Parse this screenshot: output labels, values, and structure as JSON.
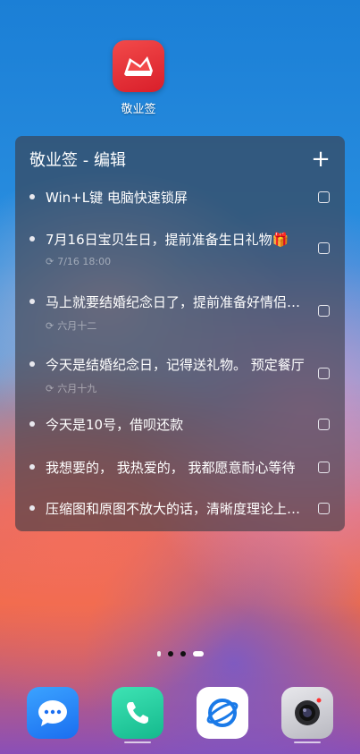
{
  "app": {
    "label": "敬业签",
    "icon": "note-app-icon"
  },
  "widget": {
    "title": "敬业签 - 编辑",
    "add_label": "+",
    "notes": [
      {
        "text": "Win+L键 电脑快速锁屏",
        "sub": ""
      },
      {
        "text": "7月16日宝贝生日，提前准备生日礼物🎁",
        "sub": "7/16 18:00"
      },
      {
        "text": "马上就要结婚纪念日了，提前准备好情侣礼物",
        "sub": "六月十二"
      },
      {
        "text": "今天是结婚纪念日，记得送礼物。 预定餐厅",
        "sub": "六月十九"
      },
      {
        "text": "今天是10号，借呗还款",
        "sub": ""
      },
      {
        "text": "我想要的， 我热爱的， 我都愿意耐心等待",
        "sub": ""
      },
      {
        "text": "压缩图和原图不放大的话，清晰度理论上一样",
        "sub": ""
      }
    ]
  },
  "pager": {
    "pages": 4,
    "active": 3
  },
  "dock": [
    "messages-app",
    "phone-app",
    "browser-app",
    "camera-app"
  ]
}
